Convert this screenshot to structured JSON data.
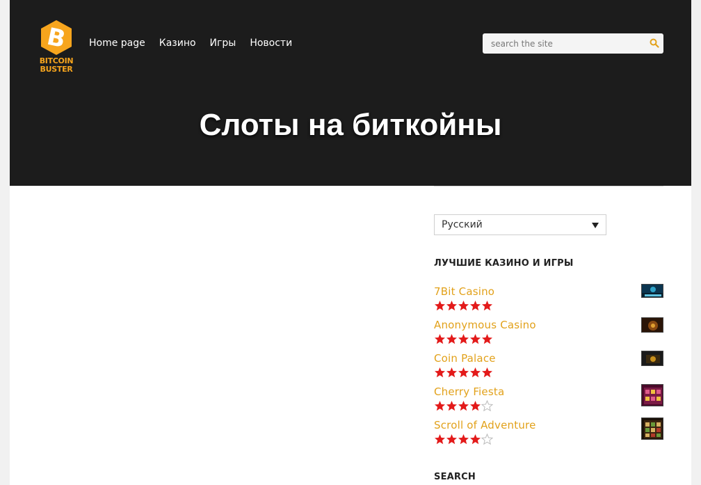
{
  "logo": {
    "line1": "BITCOIN",
    "line2": "BUSTER"
  },
  "nav": {
    "items": [
      {
        "label": "Home page"
      },
      {
        "label": "Казино"
      },
      {
        "label": "Игры"
      },
      {
        "label": "Новости"
      }
    ]
  },
  "search": {
    "placeholder": "search the site",
    "icon": "search-icon"
  },
  "page": {
    "title": "Слоты на биткойны"
  },
  "sidebar": {
    "language": {
      "selected": "Русский"
    },
    "best_title": "ЛУЧШИЕ КАЗИНО И ИГРЫ",
    "search_title": "SEARCH",
    "casinos": [
      {
        "name": "7Bit Casino",
        "rating": 5
      },
      {
        "name": "Anonymous Casino",
        "rating": 5
      },
      {
        "name": "Coin Palace",
        "rating": 5
      },
      {
        "name": "Cherry Fiesta",
        "rating": 4
      },
      {
        "name": "Scroll of Adventure",
        "rating": 4
      }
    ]
  },
  "colors": {
    "accent": "#e2a11a",
    "star": "#e31a1a",
    "header_bg": "#1c1c1c",
    "logo": "#f7a51d"
  }
}
